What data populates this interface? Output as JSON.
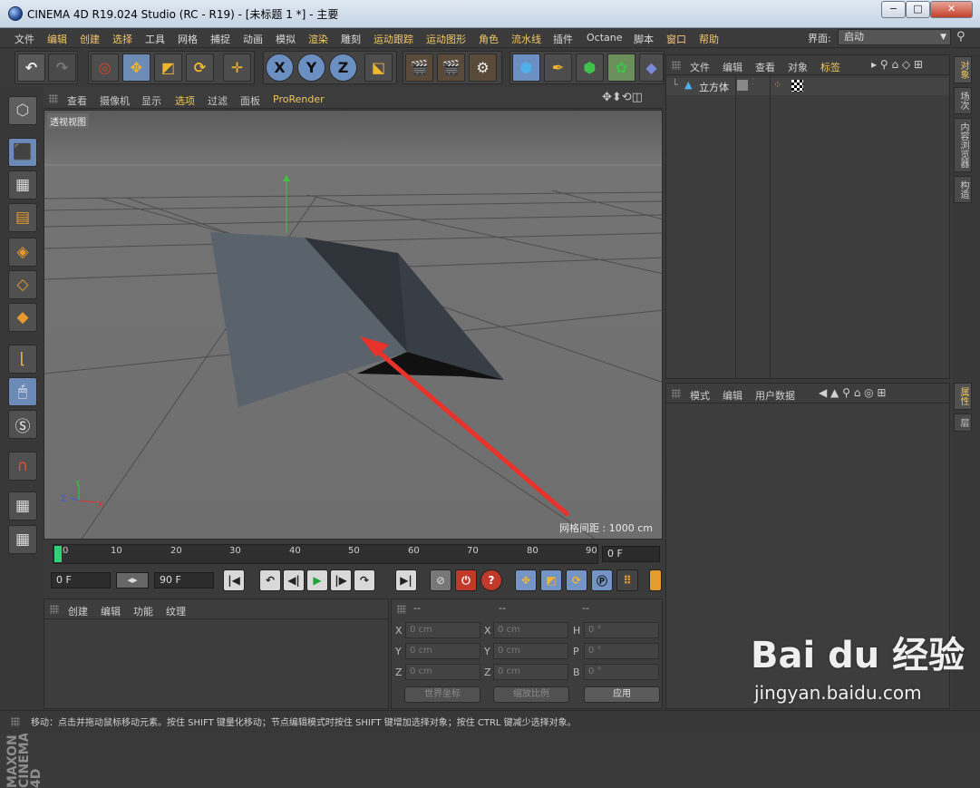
{
  "window": {
    "title": "CINEMA 4D R19.024 Studio (RC - R19) - [未标题 1 *] - 主要",
    "minimize": "−",
    "maximize": "□",
    "close": "✕"
  },
  "menu": [
    "文件",
    "编辑",
    "创建",
    "选择",
    "工具",
    "网格",
    "捕捉",
    "动画",
    "模拟",
    "渲染",
    "雕刻",
    "运动跟踪",
    "运动图形",
    "角色",
    "流水线",
    "插件",
    "Octane",
    "脚本",
    "窗口",
    "帮助"
  ],
  "layout": {
    "label": "界面:",
    "value": "启动"
  },
  "viewport": {
    "menu": [
      "查看",
      "摄像机",
      "显示",
      "选项",
      "过滤",
      "面板",
      "ProRender"
    ],
    "label": "透视视图",
    "grid_spacing": "网格间距 : 1000 cm",
    "axis_x": "X",
    "axis_y": "Y",
    "axis_z": "Z"
  },
  "timeline": {
    "ticks": [
      "0",
      "10",
      "20",
      "30",
      "40",
      "50",
      "60",
      "70",
      "80",
      "90"
    ],
    "current_frame": "0 F",
    "start_frame": "0 F",
    "end_frame": "90 F"
  },
  "material_panel": {
    "menu": [
      "创建",
      "编辑",
      "功能",
      "纹理"
    ]
  },
  "coord_panel": {
    "headers": [
      "--",
      "--",
      "--"
    ],
    "rows": [
      {
        "a": "X",
        "av": "0 cm",
        "b": "X",
        "bv": "0 cm",
        "c": "H",
        "cv": "0 °"
      },
      {
        "a": "Y",
        "av": "0 cm",
        "b": "Y",
        "bv": "0 cm",
        "c": "P",
        "cv": "0 °"
      },
      {
        "a": "Z",
        "av": "0 cm",
        "b": "Z",
        "bv": "0 cm",
        "c": "B",
        "cv": "0 °"
      }
    ],
    "world_coords": "世界坐标",
    "scale_ratio": "缩放比例",
    "apply": "应用"
  },
  "object_panel": {
    "menu": [
      "文件",
      "编辑",
      "查看",
      "对象",
      "标签"
    ],
    "objects": [
      "立方体"
    ]
  },
  "attr_panel": {
    "menu": [
      "模式",
      "编辑",
      "用户数据"
    ]
  },
  "right_tabs": [
    "对象",
    "场次",
    "内容浏览器",
    "构造"
  ],
  "right_tabs2": [
    "属性",
    "层"
  ],
  "status": "移动：点击并拖动鼠标移动元素。按住 SHIFT 键量化移动；节点编辑模式时按住 SHIFT 键增加选择对象；按住 CTRL 键减少选择对象。",
  "maxon": "MAXON CINEMA 4D",
  "watermark": {
    "brand": "Bai du 经验",
    "url": "jingyan.baidu.com"
  }
}
